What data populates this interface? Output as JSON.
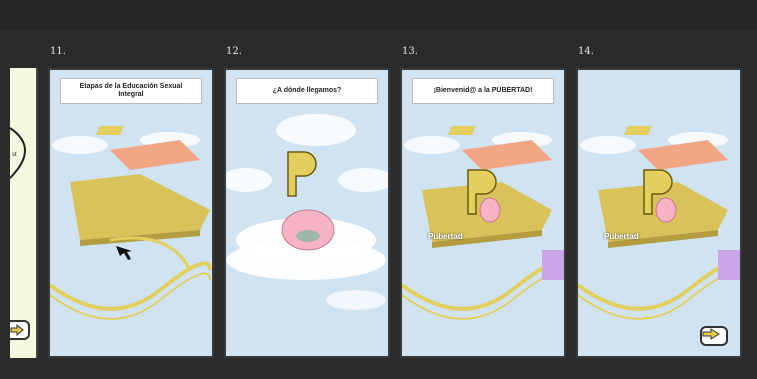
{
  "slides": [
    {
      "number": "11.",
      "title": "Etapas de la Educación Sexual Integral",
      "label": ""
    },
    {
      "number": "12.",
      "title": "¿A dónde llegamos?",
      "label": ""
    },
    {
      "number": "13.",
      "title": "¡Bienvenid@ a la PUBERTAD!",
      "label": "Pubertad"
    },
    {
      "number": "14.",
      "title": "",
      "label": "Pubertad"
    }
  ],
  "icons": {
    "next_arrow": "right-arrow-icon",
    "cursor": "move-cursor-icon",
    "p_character": "letter-p-mascot-icon"
  },
  "colors": {
    "background": "#2b2b2b",
    "sky": "#cfe3f3",
    "platform_yellow": "#d9c25a",
    "track_yellow": "#e3cf5e",
    "accent_pink": "#f39ab8",
    "accent_salmon": "#f2a784"
  }
}
